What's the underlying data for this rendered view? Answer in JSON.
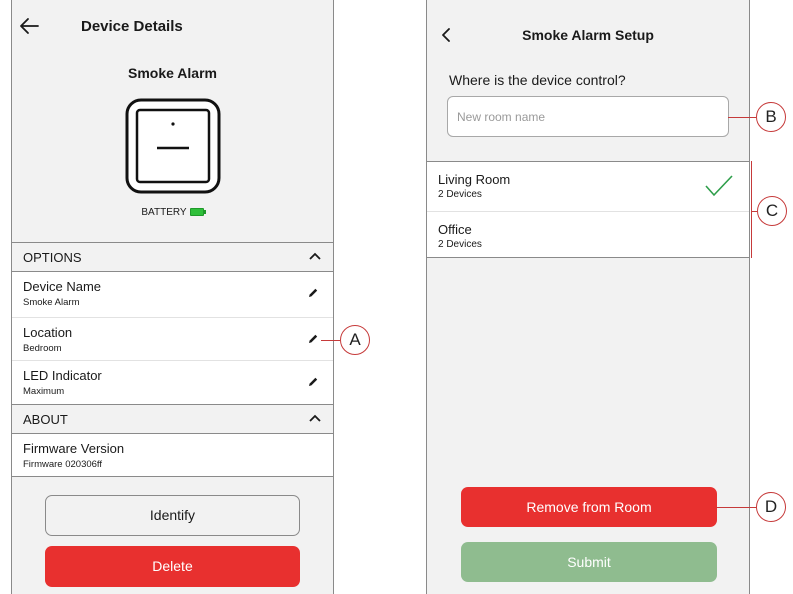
{
  "left_screen": {
    "header": {
      "title": "Device Details",
      "back_icon": "arrow-left-icon"
    },
    "device": {
      "name": "Smoke Alarm",
      "battery_label": "BATTERY",
      "battery_color": "#2fbf3a"
    },
    "options": {
      "header": "OPTIONS",
      "items": [
        {
          "title": "Device Name",
          "value": "Smoke Alarm",
          "icon": "pencil-icon"
        },
        {
          "title": "Location",
          "value": "Bedroom",
          "icon": "pencil-icon"
        },
        {
          "title": "LED Indicator",
          "value": "Maximum",
          "icon": "pencil-icon"
        }
      ]
    },
    "about": {
      "header": "ABOUT",
      "items": [
        {
          "title": "Firmware Version",
          "value": "Firmware 020306ff"
        }
      ]
    },
    "buttons": {
      "identify": "Identify",
      "delete": "Delete"
    }
  },
  "right_screen": {
    "header": {
      "title": "Smoke Alarm Setup",
      "back_icon": "chevron-left-icon"
    },
    "question": "Where is the device control?",
    "input": {
      "placeholder": "New room name",
      "value": ""
    },
    "rooms": [
      {
        "name": "Living Room",
        "devices": "2 Devices",
        "selected": true
      },
      {
        "name": "Office",
        "devices": "2 Devices",
        "selected": false
      }
    ],
    "buttons": {
      "remove": "Remove from Room",
      "submit": "Submit"
    }
  },
  "callouts": {
    "a": "A",
    "b": "B",
    "c": "C",
    "d": "D"
  },
  "colors": {
    "danger": "#e8302f",
    "submit": "#8fbc8f",
    "check": "#2e9e4a",
    "callout": "#c63a3a"
  }
}
